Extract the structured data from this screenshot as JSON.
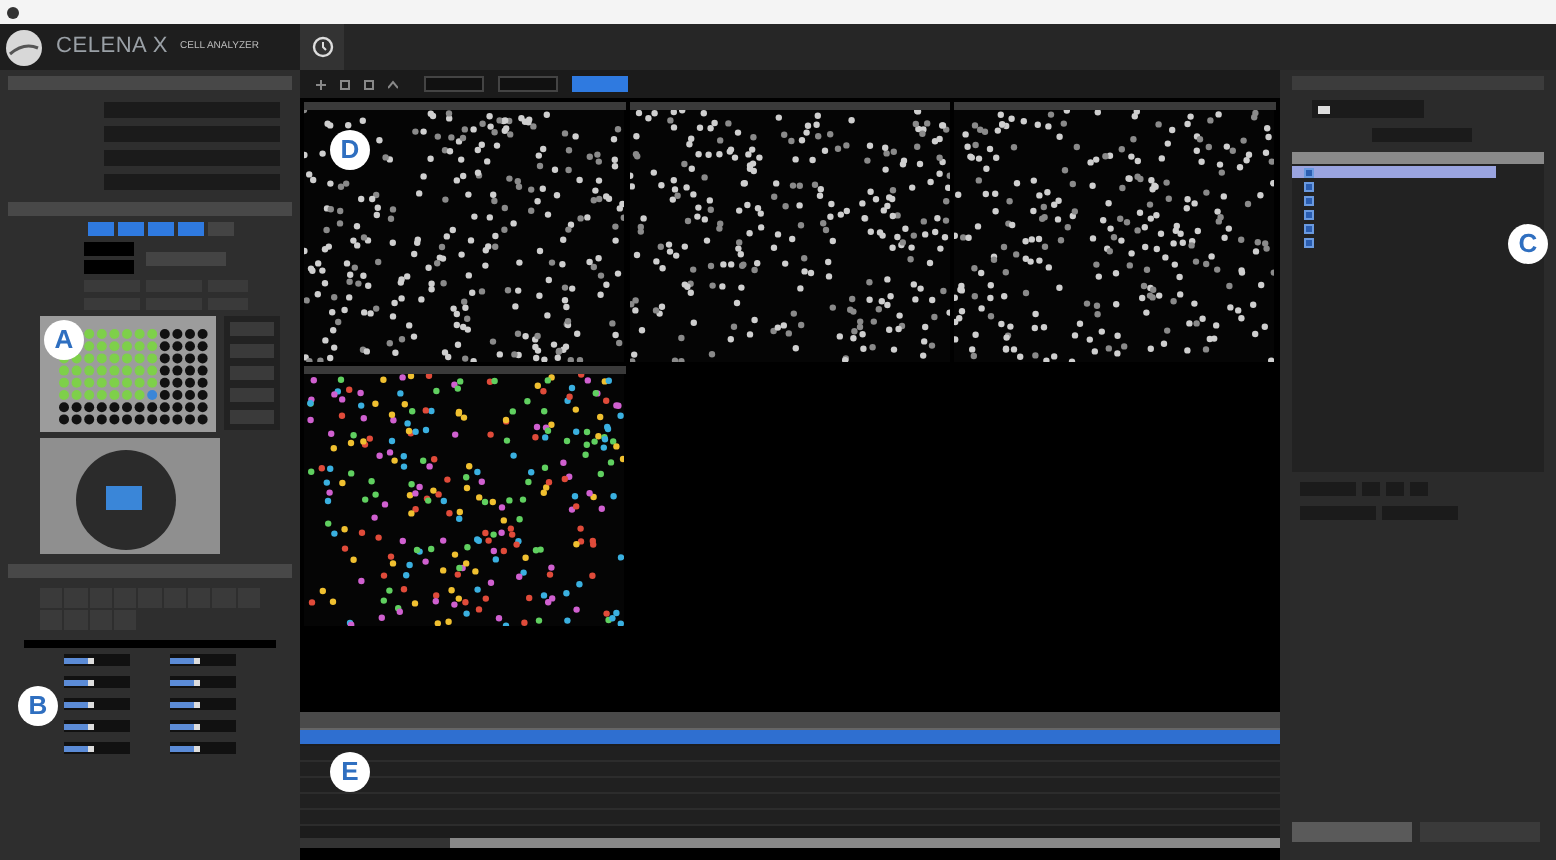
{
  "header": {
    "logo": "CELENA X",
    "product": "CELL ANALYZER"
  },
  "callouts": [
    {
      "label": "A"
    },
    {
      "label": "B"
    },
    {
      "label": "C"
    },
    {
      "label": "D"
    },
    {
      "label": "E"
    }
  ],
  "channel_buttons": [
    {
      "selected": true
    },
    {
      "selected": true
    },
    {
      "selected": true
    },
    {
      "selected": true
    },
    {
      "selected": false
    }
  ],
  "sliders": [
    {
      "level": 0.45
    },
    {
      "level": 0.45
    },
    {
      "level": 0.45
    },
    {
      "level": 0.45
    },
    {
      "level": 0.45
    },
    {
      "level": 0.45
    },
    {
      "level": 0.45
    },
    {
      "level": 0.45
    },
    {
      "level": 0.45
    },
    {
      "level": 0.45
    }
  ],
  "images": [
    {
      "kind": "grayscale"
    },
    {
      "kind": "grayscale"
    },
    {
      "kind": "grayscale"
    },
    {
      "kind": "color"
    }
  ],
  "table": {
    "rows": [
      {
        "selected": true
      },
      {
        "selected": false
      },
      {
        "selected": false
      },
      {
        "selected": false
      },
      {
        "selected": false
      },
      {
        "selected": false
      }
    ]
  },
  "pipeline_items": [
    {
      "selected": true,
      "checked": true
    },
    {
      "selected": false,
      "checked": true
    },
    {
      "selected": false,
      "checked": true
    },
    {
      "selected": false,
      "checked": true
    },
    {
      "selected": false,
      "checked": true
    },
    {
      "selected": false,
      "checked": true
    }
  ]
}
